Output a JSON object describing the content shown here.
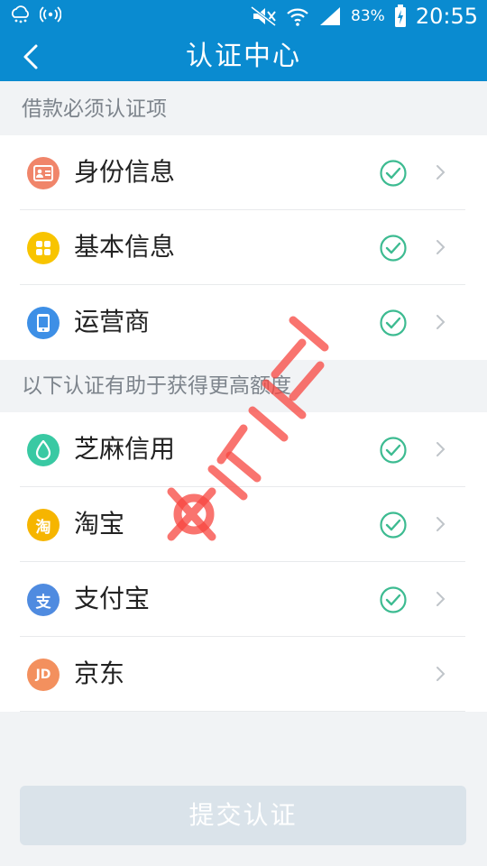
{
  "status_bar": {
    "battery": "83%",
    "time": "20:55"
  },
  "nav": {
    "title": "认证中心"
  },
  "sections": [
    {
      "header": "借款必须认证项",
      "items": [
        {
          "label": "身份信息",
          "icon": "id-card-icon",
          "icon_color": "#f0856a",
          "verified": true
        },
        {
          "label": "基本信息",
          "icon": "grid-icon",
          "icon_color": "#f8c400",
          "verified": true
        },
        {
          "label": "运营商",
          "icon": "phone-icon",
          "icon_color": "#3d8fe6",
          "verified": true
        }
      ]
    },
    {
      "header": "以下认证有助于获得更高额度",
      "items": [
        {
          "label": "芝麻信用",
          "icon": "sesame-credit-icon",
          "icon_color": "#39c9a3",
          "verified": true
        },
        {
          "label": "淘宝",
          "icon": "taobao-icon",
          "icon_glyph": "淘",
          "icon_color": "#f6b500",
          "verified": true
        },
        {
          "label": "支付宝",
          "icon": "alipay-icon",
          "icon_glyph": "支",
          "icon_color": "#4f8be0",
          "verified": true
        },
        {
          "label": "京东",
          "icon": "jd-icon",
          "icon_glyph": "JD",
          "icon_color": "#f3905e",
          "verified": false
        }
      ]
    }
  ],
  "submit_label": "提交认证",
  "colors": {
    "primary": "#0a8bd0",
    "verified_green": "#3dbb91",
    "watermark": "#f7453f"
  }
}
